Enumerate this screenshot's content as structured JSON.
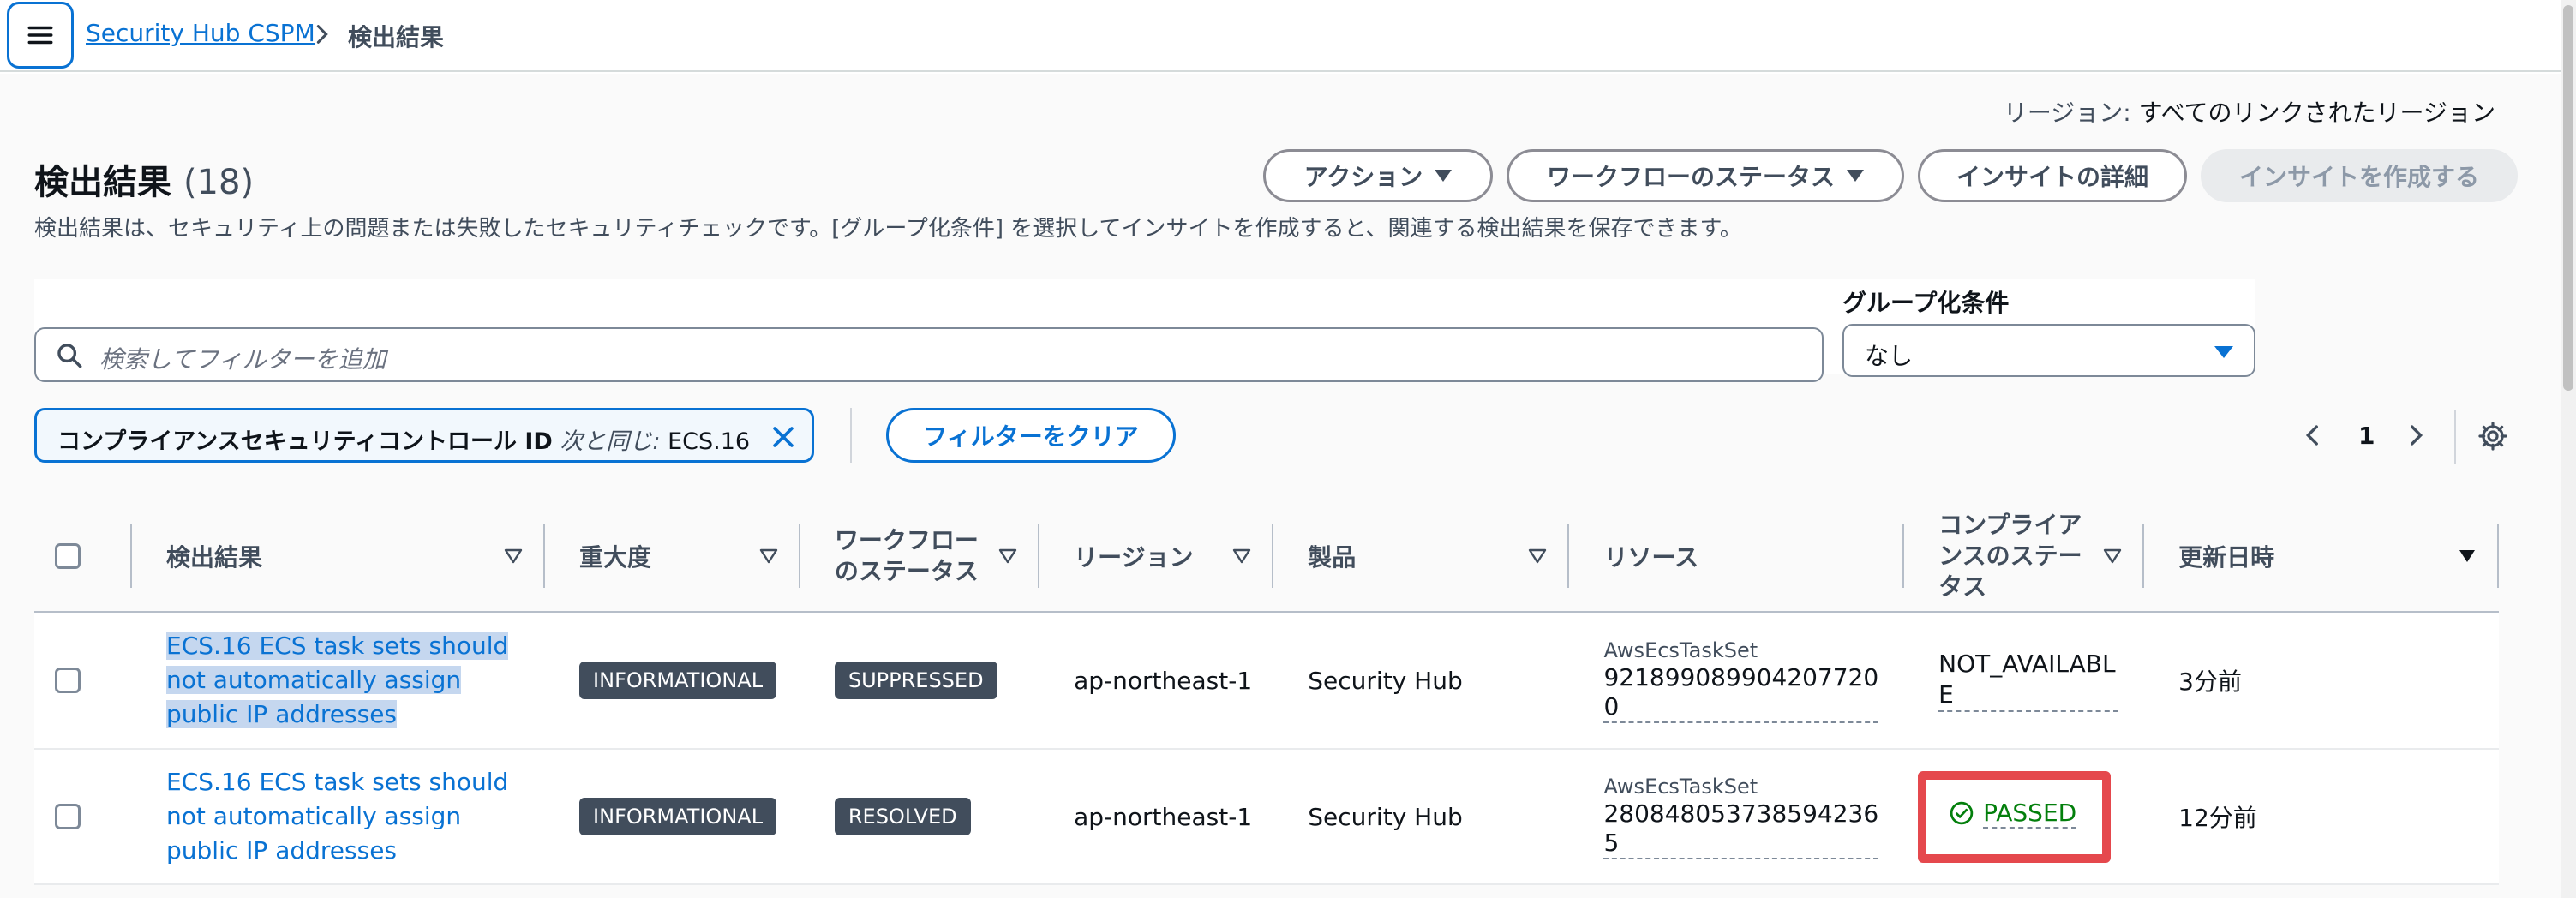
{
  "breadcrumb": {
    "root": "Security Hub CSPM",
    "current": "検出結果"
  },
  "region": {
    "label": "リージョン:",
    "value": "すべてのリンクされたリージョン"
  },
  "header": {
    "title": "検出結果",
    "count": "(18)",
    "description": "検出結果は、セキュリティ上の問題または失敗したセキュリティチェックです。[グループ化条件] を選択してインサイトを作成すると、関連する検出結果を保存できます。",
    "actions_label": "アクション",
    "workflow_label": "ワークフローのステータス",
    "insight_detail_label": "インサイトの詳細",
    "create_insight_label": "インサイトを作成する"
  },
  "search": {
    "placeholder": "検索してフィルターを追加"
  },
  "group_by": {
    "label": "グループ化条件",
    "value": "なし"
  },
  "filter_token": {
    "key": "コンプライアンスセキュリティコントロール ID",
    "operator": "次と同じ:",
    "value": "ECS.16"
  },
  "clear_filters_label": "フィルターをクリア",
  "pagination": {
    "current_page": "1"
  },
  "table": {
    "columns": [
      "検出結果",
      "重大度",
      "ワークフローのステータス",
      "リージョン",
      "製品",
      "リソース",
      "コンプライアンスのステータス",
      "更新日時"
    ],
    "rows": [
      {
        "finding": "ECS.16 ECS task sets should not automatically assign public IP addresses",
        "severity": "INFORMATIONAL",
        "workflow": "SUPPRESSED",
        "region": "ap-northeast-1",
        "product": "Security Hub",
        "resource_type": "AwsEcsTaskSet",
        "resource_id": "921899089904207720 0",
        "compliance": "NOT_AVAILABLE",
        "updated": "3分前"
      },
      {
        "finding": "ECS.16 ECS task sets should not automatically assign public IP addresses",
        "severity": "INFORMATIONAL",
        "workflow": "RESOLVED",
        "region": "ap-northeast-1",
        "product": "Security Hub",
        "resource_type": "AwsEcsTaskSet",
        "resource_id": "280848053738594236 5",
        "compliance": "PASSED",
        "updated": "12分前"
      }
    ]
  },
  "colors": {
    "link": "#0972d3",
    "passed": "#037f0c",
    "highlight_box": "#e5484d",
    "badge_bg": "#414d5c"
  }
}
